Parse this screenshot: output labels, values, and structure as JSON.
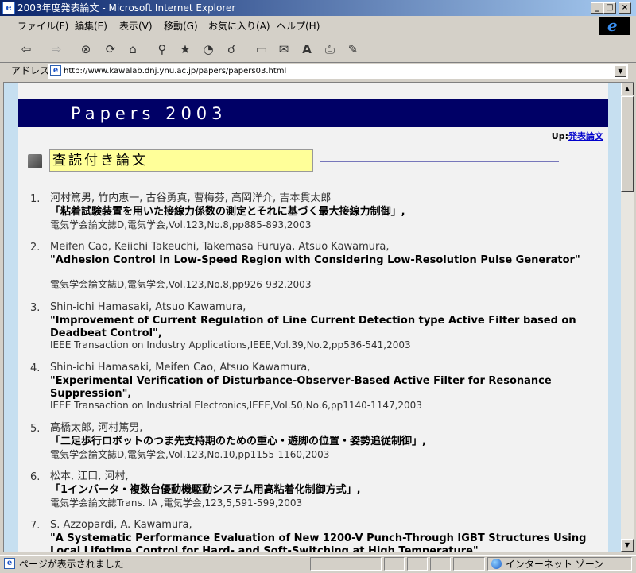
{
  "window": {
    "title": "2003年度発表論文 - Microsoft Internet Explorer",
    "minimize_glyph": "_",
    "maximize_glyph": "□",
    "close_glyph": "×"
  },
  "menu": {
    "items": [
      {
        "label": "ファイル(F)"
      },
      {
        "label": "編集(E)"
      },
      {
        "label": "表示(V)"
      },
      {
        "label": "移動(G)"
      },
      {
        "label": "お気に入り(A)"
      },
      {
        "label": "ヘルプ(H)"
      }
    ]
  },
  "toolbar": {
    "icons": [
      "back-icon",
      "forward-icon",
      "stop-icon",
      "refresh-icon",
      "home-icon",
      "search-icon",
      "favorites-icon",
      "history-icon",
      "channels-icon",
      "fullscreen-icon",
      "mail-icon",
      "font-icon",
      "print-icon",
      "edit-icon"
    ]
  },
  "address": {
    "label": "アドレス",
    "url": "http://www.kawalab.dnj.ynu.ac.jp/papers/papers03.html"
  },
  "page": {
    "header_title": "Papers 2003",
    "up_prefix": "Up:",
    "up_link": "発表論文",
    "section_title": "査読付き論文",
    "publications": [
      {
        "num": "1.",
        "authors": "河村篤男, 竹内恵一, 古谷勇真, 曹梅芬, 高岡洋介, 吉本貫太郎",
        "title": "「粘着試験装置を用いた接線力係数の測定とそれに基づく最大接線力制御」,",
        "venue": "電気学会論文誌D,電気学会,Vol.123,No.8,pp885-893,2003"
      },
      {
        "num": "2.",
        "authors": "Meifen Cao, Keiichi Takeuchi, Takemasa Furuya, Atsuo Kawamura,",
        "title": "\"Adhesion Control in Low-Speed Region with Considering Low-Resolution Pulse Generator\"",
        "venue": "電気学会論文誌D,電気学会,Vol.123,No.8,pp926-932,2003"
      },
      {
        "num": "3.",
        "authors": "Shin-ichi Hamasaki, Atsuo Kawamura,",
        "title": "\"Improvement of Current Regulation of Line Current Detection type Active Filter based on Deadbeat Control\",",
        "venue": "IEEE Transaction on Industry Applications,IEEE,Vol.39,No.2,pp536-541,2003"
      },
      {
        "num": "4.",
        "authors": "Shin-ichi Hamasaki, Meifen Cao, Atsuo Kawamura,",
        "title": "\"Experimental Verification of Disturbance-Observer-Based Active Filter for Resonance Suppression\",",
        "venue": "IEEE Transaction on Industrial Electronics,IEEE,Vol.50,No.6,pp1140-1147,2003"
      },
      {
        "num": "5.",
        "authors": "高橋太郎, 河村篤男,",
        "title": "「二足歩行ロボットのつま先支持期のための重心・遊脚の位置・姿勢追従制御」,",
        "venue": "電気学会論文誌D,電気学会,Vol.123,No.10,pp1155-1160,2003"
      },
      {
        "num": "6.",
        "authors": "松本, 江口, 河村,",
        "title": "「1インバータ・複数台優動機駆動システム用高粘着化制御方式」,",
        "venue": "電気学会論文誌Trans. IA ,電気学会,123,5,591-599,2003"
      },
      {
        "num": "7.",
        "authors": "S. Azzopardi, A. Kawamura,",
        "title": "\"A Systematic Performance Evaluation of New 1200-V Punch-Through IGBT Structures Using Local Lifetime Control for Hard- and Soft-Switching at High Temperature\"",
        "venue": ""
      }
    ]
  },
  "status": {
    "text": "ページが表示されました",
    "zone": "インターネット ゾーン"
  }
}
